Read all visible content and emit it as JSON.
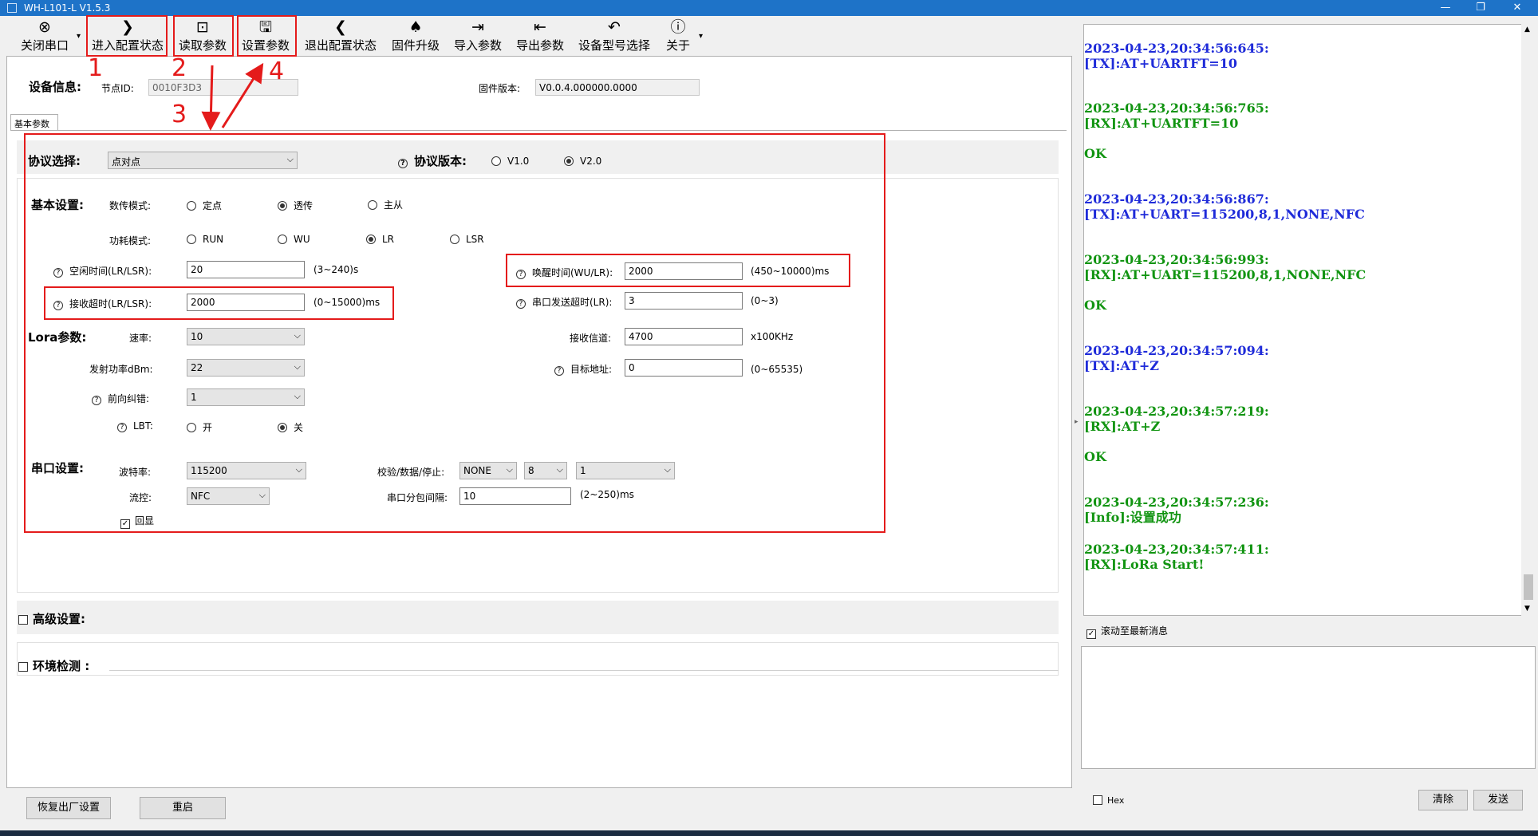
{
  "window": {
    "title": "WH-L101-L V1.5.3",
    "minimize": "—",
    "restore": "❐",
    "close": "✕"
  },
  "toolbar": {
    "items": [
      {
        "label": "关闭串口",
        "icon": "⊗"
      },
      {
        "label": "进入配置状态",
        "icon": "❯"
      },
      {
        "label": "读取参数",
        "icon": "⊡"
      },
      {
        "label": "设置参数",
        "icon": "🖫"
      },
      {
        "label": "退出配置状态",
        "icon": "❮"
      },
      {
        "label": "固件升级",
        "icon": "♠"
      },
      {
        "label": "导入参数",
        "icon": "⇥"
      },
      {
        "label": "导出参数",
        "icon": "⇤"
      },
      {
        "label": "设备型号选择",
        "icon": "↶"
      },
      {
        "label": "关于",
        "icon": "ⓘ"
      }
    ],
    "dropdown_arrow": "▾"
  },
  "annotations": {
    "n1": "1",
    "n2": "2",
    "n3": "3",
    "n4": "4"
  },
  "device": {
    "label": "设备信息:",
    "node_id_label": "节点ID:",
    "node_id": "0010F3D3",
    "fw_label": "固件版本:",
    "fw_value": "V0.0.4.000000.0000"
  },
  "tab": {
    "label": "基本参数"
  },
  "protocol": {
    "label": "协议选择:",
    "value": "点对点",
    "version_label": "协议版本:",
    "v1": "V1.0",
    "v2": "V2.0",
    "help": "?"
  },
  "basic": {
    "label": "基本设置:",
    "data_mode_label": "数传模式:",
    "data_mode_opts": [
      "定点",
      "透传",
      "主从"
    ],
    "power_mode_label": "功耗模式:",
    "power_mode_opts": [
      "RUN",
      "WU",
      "LR",
      "LSR"
    ],
    "idle_label": "空闲时间(LR/LSR):",
    "idle_value": "20",
    "idle_range": "(3~240)s",
    "wake_label": "唤醒时间(WU/LR):",
    "wake_value": "2000",
    "wake_range": "(450~10000)ms",
    "rx_timeout_label": "接收超时(LR/LSR):",
    "rx_timeout_value": "2000",
    "rx_timeout_range": "(0~15000)ms",
    "uart_timeout_label": "串口发送超时(LR):",
    "uart_timeout_value": "3",
    "uart_timeout_range": "(0~3)"
  },
  "lora": {
    "label": "Lora参数:",
    "rate_label": "速率:",
    "rate": "10",
    "power_label": "发射功率dBm:",
    "power": "22",
    "fec_label": "前向纠错:",
    "fec": "1",
    "lbt_label": "LBT:",
    "lbt_on": "开",
    "lbt_off": "关",
    "channel_label": "接收信道:",
    "channel": "4700",
    "channel_unit": "x100KHz",
    "addr_label": "目标地址:",
    "addr": "0",
    "addr_range": "(0~65535)"
  },
  "uart": {
    "label": "串口设置:",
    "baud_label": "波特率:",
    "baud": "115200",
    "flow_label": "流控:",
    "flow": "NFC",
    "parity_label": "校验/数据/停止:",
    "parity": "NONE",
    "databits": "8",
    "stopbits": "1",
    "gap_label": "串口分包间隔:",
    "gap": "10",
    "gap_range": "(2~250)ms",
    "echo_label": "回显",
    "echo_check": "✓"
  },
  "advanced": {
    "label": "高级设置:"
  },
  "env": {
    "label": "环境检测 :"
  },
  "log": {
    "entries": [
      {
        "ts": "2023-04-23,20:34:56:645:",
        "msg": "[TX]:AT+UARTFT=10",
        "kind": "tx"
      },
      {
        "ts": "2023-04-23,20:34:56:765:",
        "msg": "[RX]:AT+UARTFT=10",
        "kind": "rx"
      },
      {
        "ts": "",
        "msg": "OK",
        "kind": "rx"
      },
      {
        "ts": "2023-04-23,20:34:56:867:",
        "msg": "[TX]:AT+UART=115200,8,1,NONE,NFC",
        "kind": "tx"
      },
      {
        "ts": "2023-04-23,20:34:56:993:",
        "msg": "[RX]:AT+UART=115200,8,1,NONE,NFC",
        "kind": "rx"
      },
      {
        "ts": "",
        "msg": "OK",
        "kind": "rx"
      },
      {
        "ts": "2023-04-23,20:34:57:094:",
        "msg": "[TX]:AT+Z",
        "kind": "tx"
      },
      {
        "ts": "2023-04-23,20:34:57:219:",
        "msg": "[RX]:AT+Z",
        "kind": "rx"
      },
      {
        "ts": "",
        "msg": "OK",
        "kind": "rx"
      },
      {
        "ts": "2023-04-23,20:34:57:236:",
        "msg": "[Info]:设置成功",
        "kind": "rx"
      },
      {
        "ts": "2023-04-23,20:34:57:411:",
        "msg": "[RX]:LoRa Start!",
        "kind": "rx"
      }
    ],
    "autoscroll_label": "滚动至最新消息"
  },
  "bottom": {
    "factory_reset": "恢复出厂设置",
    "restart": "重启",
    "hex_label": "Hex",
    "clear": "清除",
    "send": "发送"
  }
}
